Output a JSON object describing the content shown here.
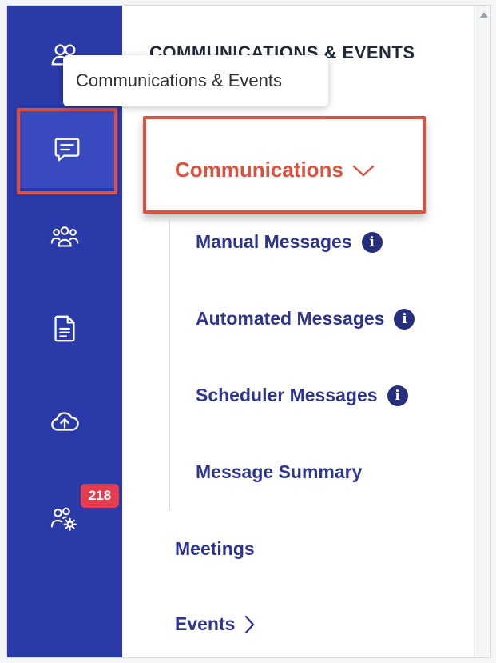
{
  "colors": {
    "rail": "#2a3aa8",
    "rail_active": "#3a4bc0",
    "highlight": "#e0503f",
    "accent_text": "#d9533e",
    "menu_text": "#2d3590",
    "badge": "#e53d4e"
  },
  "rail": {
    "items": [
      {
        "icon": "users-icon"
      },
      {
        "icon": "chat-message-icon",
        "active": true
      },
      {
        "icon": "group-icon"
      },
      {
        "icon": "document-icon"
      },
      {
        "icon": "cloud-upload-icon"
      },
      {
        "icon": "user-settings-icon",
        "badge": "218"
      }
    ]
  },
  "tooltip": "Communications & Events",
  "panel": {
    "section_title": "COMMUNICATIONS & EVENTS",
    "communications": {
      "label": "Communications",
      "expanded": true
    },
    "sub_items": [
      {
        "label": "Manual Messages",
        "info_icon": true
      },
      {
        "label": "Automated Messages",
        "info_icon": true
      },
      {
        "label": "Scheduler Messages",
        "info_icon": true
      },
      {
        "label": "Message Summary",
        "info_icon": false
      }
    ],
    "meetings": "Meetings",
    "events": "Events"
  }
}
